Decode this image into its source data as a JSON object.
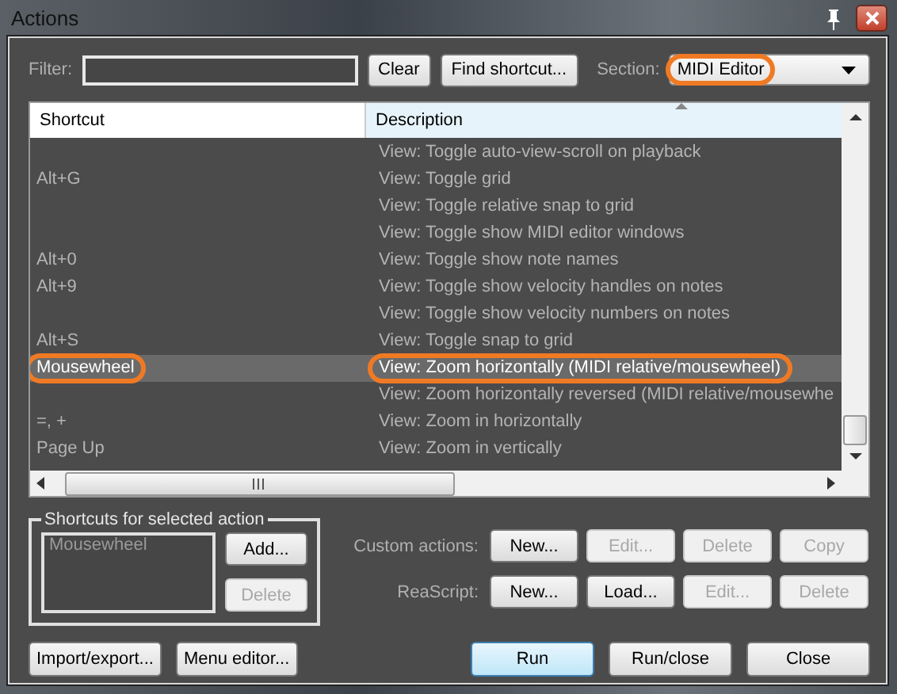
{
  "window": {
    "title": "Actions"
  },
  "filter": {
    "label": "Filter:"
  },
  "filter_buttons": [
    "Clear",
    "Find shortcut..."
  ],
  "section": {
    "label": "Section:",
    "value": "MIDI Editor",
    "highlighted": true
  },
  "table": {
    "columns": [
      "Shortcut",
      "Description"
    ],
    "rows": [
      {
        "shortcut": "",
        "description": "View: Toggle auto-view-scroll on playback",
        "selected": false,
        "highlighted": false
      },
      {
        "shortcut": "Alt+G",
        "description": "View: Toggle grid",
        "selected": false,
        "highlighted": false
      },
      {
        "shortcut": "",
        "description": "View: Toggle relative snap to grid",
        "selected": false,
        "highlighted": false
      },
      {
        "shortcut": "",
        "description": "View: Toggle show MIDI editor windows",
        "selected": false,
        "highlighted": false
      },
      {
        "shortcut": "Alt+0",
        "description": "View: Toggle show note names",
        "selected": false,
        "highlighted": false
      },
      {
        "shortcut": "Alt+9",
        "description": "View: Toggle show velocity handles on notes",
        "selected": false,
        "highlighted": false
      },
      {
        "shortcut": "",
        "description": "View: Toggle show velocity numbers on notes",
        "selected": false,
        "highlighted": false
      },
      {
        "shortcut": "Alt+S",
        "description": "View: Toggle snap to grid",
        "selected": false,
        "highlighted": false
      },
      {
        "shortcut": "Mousewheel",
        "description": "View: Zoom horizontally (MIDI relative/mousewheel)",
        "selected": true,
        "highlighted": true
      },
      {
        "shortcut": "",
        "description": "View: Zoom horizontally reversed (MIDI relative/mousewhe",
        "selected": false,
        "highlighted": false
      },
      {
        "shortcut": "=, +",
        "description": "View: Zoom in horizontally",
        "selected": false,
        "highlighted": false
      },
      {
        "shortcut": "Page Up",
        "description": "View: Zoom in vertically",
        "selected": false,
        "highlighted": false
      }
    ]
  },
  "shortcuts_group": {
    "title": "Shortcuts for selected action",
    "items": [
      "Mousewheel"
    ],
    "buttons": [
      {
        "label": "Add...",
        "disabled": false
      },
      {
        "label": "Delete",
        "disabled": true
      }
    ]
  },
  "action_rows": [
    {
      "label": "Custom actions:",
      "buttons": [
        {
          "label": "New...",
          "disabled": false
        },
        {
          "label": "Edit...",
          "disabled": true
        },
        {
          "label": "Delete",
          "disabled": true
        },
        {
          "label": "Copy",
          "disabled": true
        }
      ]
    },
    {
      "label": "ReaScript:",
      "buttons": [
        {
          "label": "New...",
          "disabled": false
        },
        {
          "label": "Load...",
          "disabled": false
        },
        {
          "label": "Edit...",
          "disabled": true
        },
        {
          "label": "Delete",
          "disabled": true
        }
      ]
    }
  ],
  "bottom_left_buttons": [
    "Import/export...",
    "Menu editor..."
  ],
  "bottom_right_buttons": [
    {
      "label": "Run",
      "default": true
    },
    {
      "label": "Run/close",
      "default": false
    },
    {
      "label": "Close",
      "default": false
    }
  ]
}
